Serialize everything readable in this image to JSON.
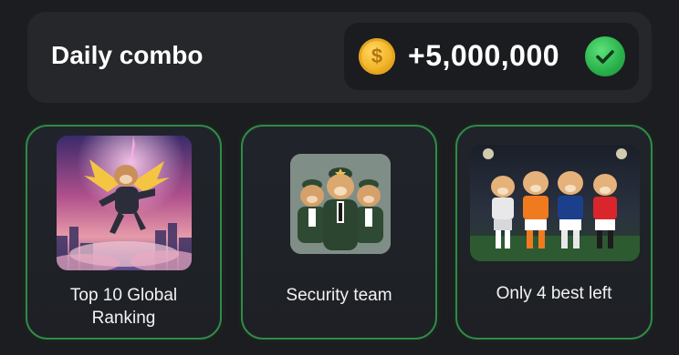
{
  "header": {
    "title": "Daily combo",
    "reward": "+5,000,000",
    "coin_symbol": "$"
  },
  "cards": [
    {
      "label_line1": "Top 10 Global",
      "label_line2": "Ranking"
    },
    {
      "label": "Security team"
    },
    {
      "label": "Only 4 best left"
    }
  ],
  "colors": {
    "background": "#1c1d20",
    "panel": "#26272b",
    "card_border": "#2e8c45",
    "coin": "#f3b428",
    "check": "#28b04a"
  }
}
